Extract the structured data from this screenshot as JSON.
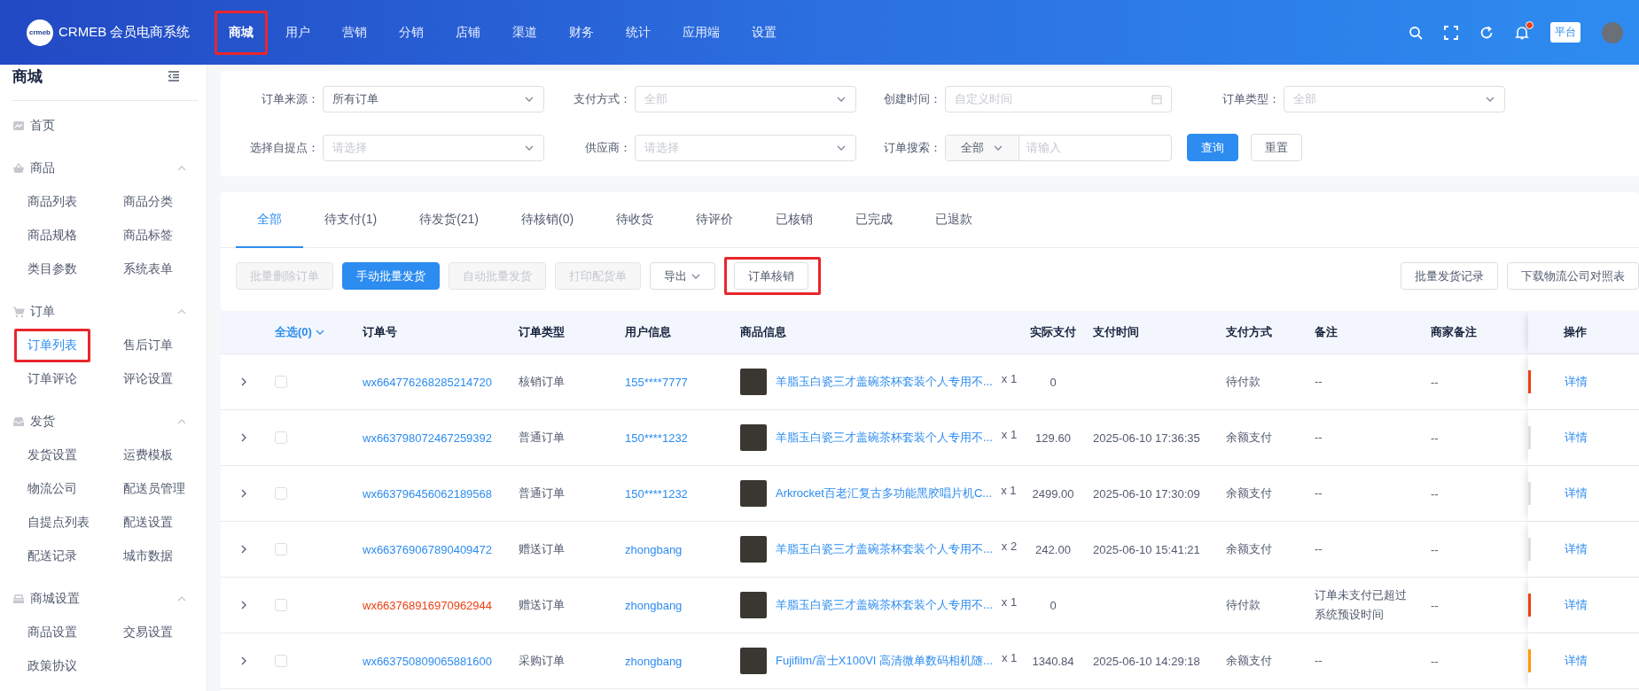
{
  "header": {
    "logo_mark": "crmeb",
    "logo_text": "CRMEB 会员电商系统",
    "nav": [
      {
        "label": "商城",
        "selected": true,
        "annotated": true
      },
      {
        "label": "用户",
        "selected": false,
        "annotated": false
      },
      {
        "label": "营销",
        "selected": false,
        "annotated": false
      },
      {
        "label": "分销",
        "selected": false,
        "annotated": false
      },
      {
        "label": "店铺",
        "selected": false,
        "annotated": false
      },
      {
        "label": "渠道",
        "selected": false,
        "annotated": false
      },
      {
        "label": "财务",
        "selected": false,
        "annotated": false
      },
      {
        "label": "统计",
        "selected": false,
        "annotated": false
      },
      {
        "label": "应用端",
        "selected": false,
        "annotated": false
      },
      {
        "label": "设置",
        "selected": false,
        "annotated": false
      }
    ],
    "notification": true,
    "badge": "平台"
  },
  "sidebar": {
    "title": "商城",
    "items": [
      {
        "kind": "link",
        "label": "首页"
      },
      {
        "kind": "group",
        "label": "商品",
        "expanded": true,
        "children": [
          {
            "label": "商品列表",
            "selected": false,
            "annotated": false
          },
          {
            "label": "商品分类",
            "selected": false,
            "annotated": false
          },
          {
            "label": "商品规格",
            "selected": false,
            "annotated": false
          },
          {
            "label": "商品标签",
            "selected": false,
            "annotated": false
          },
          {
            "label": "类目参数",
            "selected": false,
            "annotated": false
          },
          {
            "label": "系统表单",
            "selected": false,
            "annotated": false
          }
        ]
      },
      {
        "kind": "group",
        "label": "订单",
        "expanded": true,
        "children": [
          {
            "label": "订单列表",
            "selected": true,
            "annotated": true
          },
          {
            "label": "售后订单",
            "selected": false,
            "annotated": false
          },
          {
            "label": "订单评论",
            "selected": false,
            "annotated": false
          },
          {
            "label": "评论设置",
            "selected": false,
            "annotated": false
          }
        ]
      },
      {
        "kind": "group",
        "label": "发货",
        "expanded": true,
        "children": [
          {
            "label": "发货设置",
            "selected": false,
            "annotated": false
          },
          {
            "label": "运费模板",
            "selected": false,
            "annotated": false
          },
          {
            "label": "物流公司",
            "selected": false,
            "annotated": false
          },
          {
            "label": "配送员管理",
            "selected": false,
            "annotated": false
          },
          {
            "label": "自提点列表",
            "selected": false,
            "annotated": false
          },
          {
            "label": "配送设置",
            "selected": false,
            "annotated": false
          },
          {
            "label": "配送记录",
            "selected": false,
            "annotated": false
          },
          {
            "label": "城市数据",
            "selected": false,
            "annotated": false
          }
        ]
      },
      {
        "kind": "group",
        "label": "商城设置",
        "expanded": true,
        "children": [
          {
            "label": "商品设置",
            "selected": false,
            "annotated": false
          },
          {
            "label": "交易设置",
            "selected": false,
            "annotated": false
          },
          {
            "label": "政策协议",
            "selected": false,
            "annotated": false
          }
        ]
      }
    ]
  },
  "filters": {
    "rows": [
      [
        {
          "kind": "select",
          "label": "订单来源：",
          "value": "所有订单"
        },
        {
          "kind": "select",
          "label": "支付方式：",
          "placeholder": "全部"
        },
        {
          "kind": "date",
          "label": "创建时间：",
          "placeholder": "自定义时间"
        },
        {
          "kind": "select",
          "label": "订单类型：",
          "placeholder": "全部"
        }
      ],
      [
        {
          "kind": "select",
          "label": "选择自提点：",
          "placeholder": "请选择"
        },
        {
          "kind": "select",
          "label": "供应商：",
          "placeholder": "请选择"
        },
        {
          "kind": "search",
          "label": "订单搜索：",
          "scope": "全部",
          "placeholder": "请输入"
        }
      ]
    ],
    "buttons": [
      {
        "label": "查询",
        "primary": true
      },
      {
        "label": "重置",
        "primary": false
      }
    ]
  },
  "tabs": [
    {
      "label": "全部",
      "selected": true
    },
    {
      "label": "待支付(1)",
      "selected": false
    },
    {
      "label": "待发货(21)",
      "selected": false
    },
    {
      "label": "待核销(0)",
      "selected": false
    },
    {
      "label": "待收货",
      "selected": false
    },
    {
      "label": "待评价",
      "selected": false
    },
    {
      "label": "已核销",
      "selected": false
    },
    {
      "label": "已完成",
      "selected": false
    },
    {
      "label": "已退款",
      "selected": false
    }
  ],
  "actions": {
    "left": [
      {
        "kind": "button",
        "label": "批量删除订单",
        "primary": false,
        "disabled": true,
        "annotated": false
      },
      {
        "kind": "button",
        "label": "手动批量发货",
        "primary": true,
        "disabled": false,
        "annotated": false
      },
      {
        "kind": "button",
        "label": "自动批量发货",
        "primary": false,
        "disabled": true,
        "annotated": false
      },
      {
        "kind": "button",
        "label": "打印配货单",
        "primary": false,
        "disabled": true,
        "annotated": false
      },
      {
        "kind": "dropdown",
        "label": "导出",
        "primary": false,
        "disabled": false,
        "annotated": false
      },
      {
        "kind": "button",
        "label": "订单核销",
        "primary": false,
        "disabled": false,
        "annotated": true
      }
    ],
    "right": [
      {
        "label": "批量发货记录",
        "primary": false,
        "disabled": false,
        "annotated": false
      },
      {
        "label": "下载物流公司对照表",
        "primary": false,
        "disabled": false,
        "annotated": false
      }
    ]
  },
  "table": {
    "select_all": "全选(0)",
    "columns": [
      "订单号",
      "订单类型",
      "用户信息",
      "商品信息",
      "实际支付",
      "支付时间",
      "支付方式",
      "备注",
      "商家备注",
      "操作"
    ],
    "rows": [
      {
        "checked": false,
        "order_no": "wx664776268285214720",
        "expired": false,
        "type": "核销订单",
        "user": "155****7777",
        "product": "羊脂玉白瓷三才盖碗茶杯套装个人专用不...",
        "quantity": "x 1",
        "paid": "0",
        "pay_method": "待付款",
        "note": "--",
        "merchant_note": "--",
        "color": "#ed4014",
        "action": "详情"
      },
      {
        "checked": false,
        "order_no": "wx663798072467259392",
        "expired": false,
        "type": "普通订单",
        "user": "150****1232",
        "product": "羊脂玉白瓷三才盖碗茶杯套装个人专用不...",
        "quantity": "x 1",
        "paid": "129.60",
        "pay_time": "2025-06-10 17:36:35",
        "pay_method": "余额支付",
        "note": "--",
        "merchant_note": "--",
        "color": "#dcdee2",
        "action": "详情"
      },
      {
        "checked": false,
        "order_no": "wx663796456062189568",
        "expired": false,
        "type": "普通订单",
        "user": "150****1232",
        "product": "Arkrocket百老汇复古多功能黑胶唱片机C...",
        "quantity": "x 1",
        "paid": "2499.00",
        "pay_time": "2025-06-10 17:30:09",
        "pay_method": "余额支付",
        "note": "--",
        "merchant_note": "--",
        "color": "#dcdee2",
        "action": "详情"
      },
      {
        "checked": false,
        "order_no": "wx663769067890409472",
        "expired": false,
        "type": "赠送订单",
        "user": "zhongbang",
        "product": "羊脂玉白瓷三才盖碗茶杯套装个人专用不...",
        "quantity": "x 2",
        "paid": "242.00",
        "pay_time": "2025-06-10 15:41:21",
        "pay_method": "余额支付",
        "note": "--",
        "merchant_note": "--",
        "color": "#dcdee2",
        "action": "详情"
      },
      {
        "checked": false,
        "order_no": "wx663768916970962944",
        "expired": true,
        "type": "赠送订单",
        "user": "zhongbang",
        "product": "羊脂玉白瓷三才盖碗茶杯套装个人专用不...",
        "quantity": "x 1",
        "paid": "0",
        "pay_method": "待付款",
        "note": "订单未支付已超过系统预设时间",
        "merchant_note": "--",
        "color": "#ed4014",
        "action": "详情"
      },
      {
        "checked": false,
        "order_no": "wx663750809065881600",
        "expired": false,
        "type": "采购订单",
        "user": "zhongbang",
        "product": "Fujifilm/富士X100VI 高清微单数码相机随...",
        "quantity": "x 1",
        "paid": "1340.84",
        "pay_time": "2025-06-10 14:29:18",
        "pay_method": "余额支付",
        "note": "--",
        "merchant_note": "--",
        "color": "#ff9900",
        "action": "详情"
      }
    ]
  }
}
